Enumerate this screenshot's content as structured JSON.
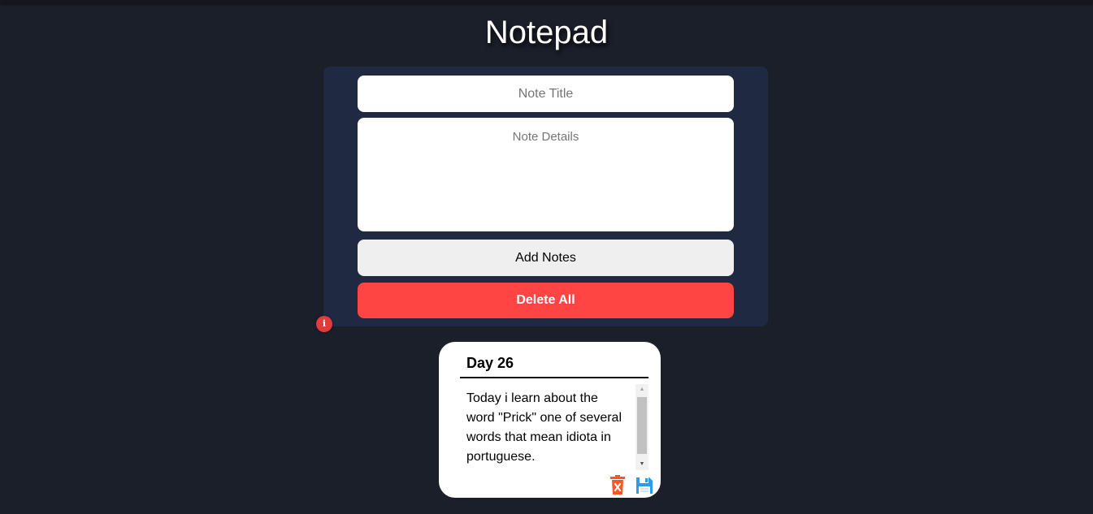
{
  "app": {
    "title": "Notepad"
  },
  "form": {
    "title_placeholder": "Note Title",
    "details_placeholder": "Note Details",
    "add_label": "Add Notes",
    "delete_all_label": "Delete All"
  },
  "info": {
    "icon": "info-icon",
    "glyph": "i"
  },
  "notes": [
    {
      "title": "Day 26",
      "body": "Today i learn about the word \"Prick\" one of several words that mean idiota in portuguese."
    }
  ],
  "colors": {
    "background": "#1b1f2a",
    "panel": "#1f2a42",
    "delete_accent": "#ff4444",
    "info_badge": "#e23b3b",
    "trash_icon": "#ff5722",
    "save_icon": "#2e9be6"
  }
}
